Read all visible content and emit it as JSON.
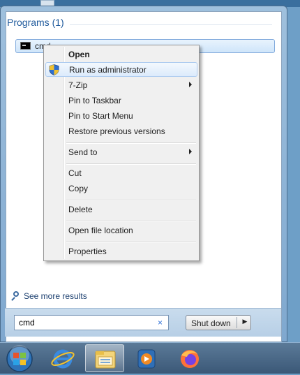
{
  "start_menu": {
    "section_header": "Programs (1)",
    "result_label": "cmd",
    "see_more": "See more results",
    "search_value": "cmd",
    "clear_glyph": "×",
    "shutdown_label": "Shut down",
    "shutdown_arrow": "▶"
  },
  "context_menu": {
    "items": [
      {
        "label": "Open",
        "bold": true
      },
      {
        "label": "Run as administrator",
        "icon": "uac-shield-icon"
      },
      {
        "label": "7-Zip",
        "submenu": true
      },
      {
        "label": "Pin to Taskbar"
      },
      {
        "label": "Pin to Start Menu"
      },
      {
        "label": "Restore previous versions"
      },
      {
        "label": "Send to",
        "submenu": true
      },
      {
        "label": "Cut"
      },
      {
        "label": "Copy"
      },
      {
        "label": "Delete"
      },
      {
        "label": "Open file location"
      },
      {
        "label": "Properties"
      }
    ]
  },
  "taskbar": {
    "items": [
      "start-orb-icon",
      "internet-explorer-icon",
      "file-explorer-icon",
      "media-player-icon",
      "firefox-icon"
    ]
  },
  "colors": {
    "accent": "#1f5a9c",
    "highlight_border": "#aeccf0",
    "taskbar": "#3b5877"
  }
}
